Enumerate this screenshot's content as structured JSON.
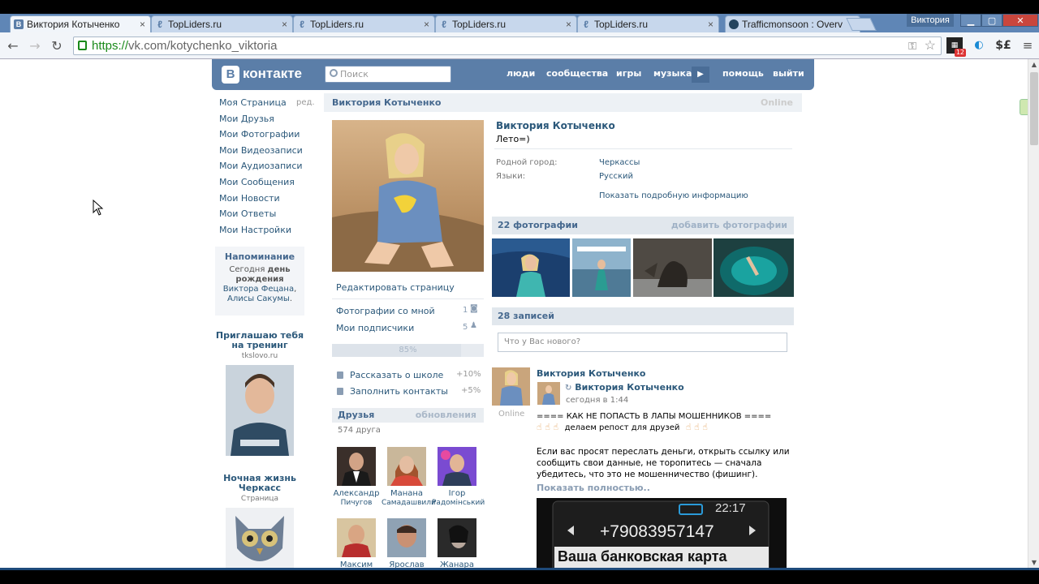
{
  "browser": {
    "tabs": [
      {
        "title": "Виктория Котыченко",
        "icon": "vk-icon"
      },
      {
        "title": "TopLiders.ru",
        "icon": "topliders-icon"
      },
      {
        "title": "TopLiders.ru",
        "icon": "topliders-icon"
      },
      {
        "title": "TopLiders.ru",
        "icon": "topliders-icon"
      },
      {
        "title": "TopLiders.ru",
        "icon": "topliders-icon"
      },
      {
        "title": "Trafficmonsoon : Overv",
        "icon": "trafficmonsoon-icon"
      }
    ],
    "window_user": "Виктория",
    "url_https": "https://",
    "url_rest": "vk.com/kotychenko_viktoria",
    "ext_badge": "12",
    "ext_currency": "$£"
  },
  "vk": {
    "logo": "контакте",
    "search_placeholder": "Поиск",
    "nav": [
      "люди",
      "сообщества",
      "игры",
      "музыка",
      "помощь",
      "выйти"
    ]
  },
  "left_menu": {
    "items": [
      "Моя Страница",
      "Мои Друзья",
      "Мои Фотографии",
      "Мои Видеозаписи",
      "Мои Аудиозаписи",
      "Мои Сообщения",
      "Мои Новости",
      "Мои Ответы",
      "Мои Настройки"
    ],
    "edit": "ред."
  },
  "reminder": {
    "title": "Напоминание",
    "text_a": "Сегодня ",
    "text_b": "день рождения ",
    "link1": "Виктора Фецана",
    "text_c": ", ",
    "link2": "Алисы Сакумы",
    "text_d": "."
  },
  "promo1": {
    "title": "Приглашаю тебя на тренинг",
    "sub": "tkslovo.ru"
  },
  "promo2": {
    "title": "Ночная жизнь Черкасс",
    "sub": "Страница"
  },
  "profile": {
    "header_name": "Виктория Котыченко",
    "header_status": "Online",
    "name": "Виктория Котыченко",
    "status": "Лето=)",
    "info": [
      {
        "k": "Родной город:",
        "v": "Черкассы"
      },
      {
        "k": "Языки:",
        "v": "Русский"
      }
    ],
    "show_more": "Показать подробную информацию",
    "edit": "Редактировать страницу",
    "photos_with_me": "Фотографии со мной",
    "photos_with_me_count": "1",
    "subscribers": "Мои подписчики",
    "subscribers_count": "5",
    "progress_label": "85%",
    "progress": 0.85,
    "tips": [
      {
        "label": "Рассказать о школе",
        "pct": "+10%"
      },
      {
        "label": "Заполнить контакты",
        "pct": "+5%"
      }
    ],
    "friends_header": "Друзья",
    "friends_updates": "обновления",
    "friends_count": "574 друга",
    "friends": [
      {
        "first": "Александр",
        "last": "Пичугов"
      },
      {
        "first": "Манана",
        "last": "Самадашвили"
      },
      {
        "first": "Ігор",
        "last": "Радомінський"
      },
      {
        "first": "Максим",
        "last": ""
      },
      {
        "first": "Ярослав",
        "last": ""
      },
      {
        "first": "Жанара",
        "last": ""
      }
    ]
  },
  "photos": {
    "header": "22 фотографии",
    "add": "добавить фотографии"
  },
  "wall": {
    "header": "28 записей",
    "placeholder": "Что у Вас нового?",
    "author": "Виктория Котыченко",
    "online": "Online",
    "repost_name": "Виктория Котыченко",
    "repost_date": "сегодня в 1:44",
    "line1": "==== КАК НЕ ПОПАСТЬ В ЛАПЫ МОШЕННИКОВ ====",
    "line2": "делаем репост для друзей",
    "body": "Если вас просят переслать деньги, открыть ссылку или сообщить свои данные, не торопитесь — сначала убедитесь, что это не мошенничество (фишинг).",
    "show_all": "Показать полностью..",
    "phone_number": "+79083957147",
    "phone_time": "22:17",
    "phone_caption": "Ваша банковская карта"
  },
  "colors": {
    "vk_blue": "#5b7ea8",
    "link": "#2b587a",
    "https_green": "#1a8a1a"
  }
}
